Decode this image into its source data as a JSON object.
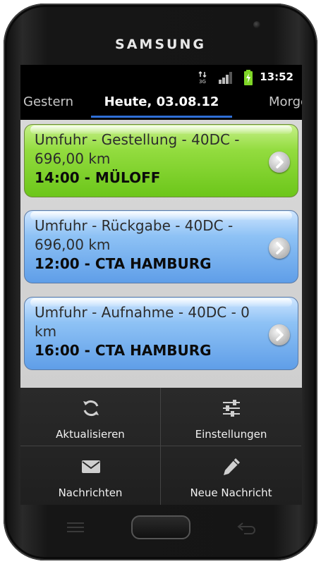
{
  "device": {
    "brand": "SAMSUNG"
  },
  "status_bar": {
    "network": "3G",
    "time": "13:52"
  },
  "date_tabs": {
    "prev": "Gestern",
    "current": "Heute, 03.08.12",
    "next": "Morgen"
  },
  "jobs": [
    {
      "title": "Umfuhr - Gestellung - 40DC - 696,00 km",
      "subtitle": "14:00 - MÜLOFF",
      "color": "#7ccd28"
    },
    {
      "title": "Umfuhr - Rückgabe - 40DC - 696,00 km",
      "subtitle": "12:00 - CTA HAMBURG",
      "color": "#72abee"
    },
    {
      "title": "Umfuhr - Aufnahme - 40DC - 0 km",
      "subtitle": "16:00 - CTA HAMBURG",
      "color": "#72abee"
    }
  ],
  "menu": {
    "refresh": {
      "label": "Aktualisieren",
      "icon": "refresh-icon"
    },
    "settings": {
      "label": "Einstellungen",
      "icon": "sliders-icon"
    },
    "messages": {
      "label": "Nachrichten",
      "icon": "envelope-icon"
    },
    "new_message": {
      "label": "Neue Nachricht",
      "icon": "pencil-icon"
    }
  }
}
